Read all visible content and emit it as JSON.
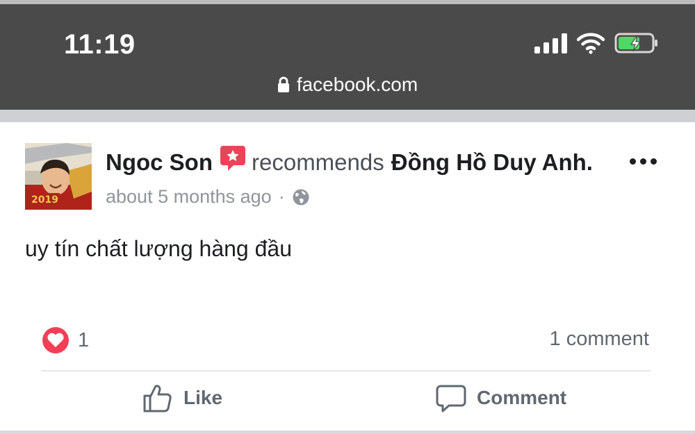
{
  "status_bar": {
    "time": "11:19",
    "icons": [
      "cellular-signal-icon",
      "wifi-icon",
      "battery-charging-icon"
    ],
    "battery_color": "#4cd964"
  },
  "browser": {
    "url": "facebook.com",
    "icon": "lock-icon"
  },
  "post": {
    "author": "Ngoc Son",
    "recommendation_icon": "recommendation-icon",
    "recommendation_color": "#e9445a",
    "action_text": "recommends",
    "page_name": "Đồng Hồ Duy Anh.",
    "timestamp": "about 5 months ago",
    "separator": "·",
    "privacy_icon": "globe-icon",
    "body": "uy tín chất lượng hàng đầu",
    "reaction_icon": "love-reaction-icon",
    "reaction_count": "1",
    "comment_count": "1 comment",
    "actions": {
      "like_label": "Like",
      "comment_label": "Comment"
    }
  }
}
